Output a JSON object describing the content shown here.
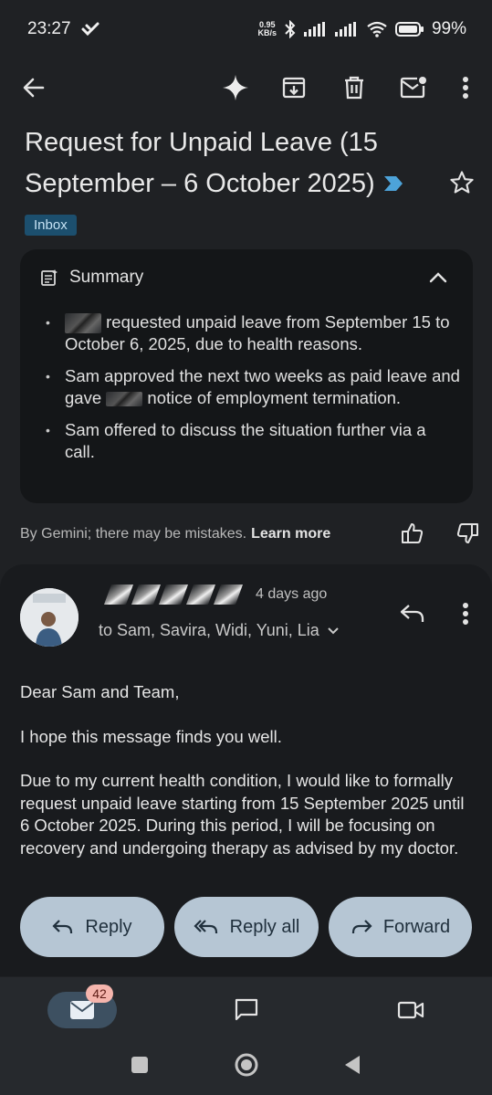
{
  "status_bar": {
    "time": "23:27",
    "net_speed_value": "0.95",
    "net_speed_unit": "KB/s",
    "battery": "99%"
  },
  "email": {
    "subject": "Request for Unpaid Leave (15 September – 6 October 2025)",
    "label": "Inbox",
    "summary": {
      "title": "Summary",
      "points": [
        {
          "before": "",
          "after": " requested unpaid leave from September 15 to October 6, 2025, due to health reasons."
        },
        {
          "before": "Sam approved the next two weeks as paid leave and gave ",
          "after": " notice of employment termination."
        },
        {
          "before": "Sam offered to discuss the situation further via a call.",
          "after": ""
        }
      ],
      "disclaimer": "By Gemini; there may be mistakes.",
      "learn_more": "Learn more"
    },
    "message": {
      "date": "4 days ago",
      "to": "to Sam, Savira, Widi, Yuni, Lia",
      "body": [
        "Dear Sam and Team,",
        "I hope this message finds you well.",
        "Due to my current health condition, I would like to formally request unpaid leave starting from 15 September 2025 until 6 October 2025. During this period, I will be focusing on recovery and undergoing therapy as advised by my doctor."
      ]
    }
  },
  "actions": {
    "reply": "Reply",
    "reply_all": "Reply all",
    "forward": "Forward"
  },
  "bottom_nav": {
    "mail_badge": "42"
  },
  "colors": {
    "background": "#1f2124",
    "card": "#141618",
    "chip": "#1c4f6e",
    "action_button": "#b6c6d4",
    "importance": "#4da3d9",
    "badge": "#f5b5ad"
  }
}
